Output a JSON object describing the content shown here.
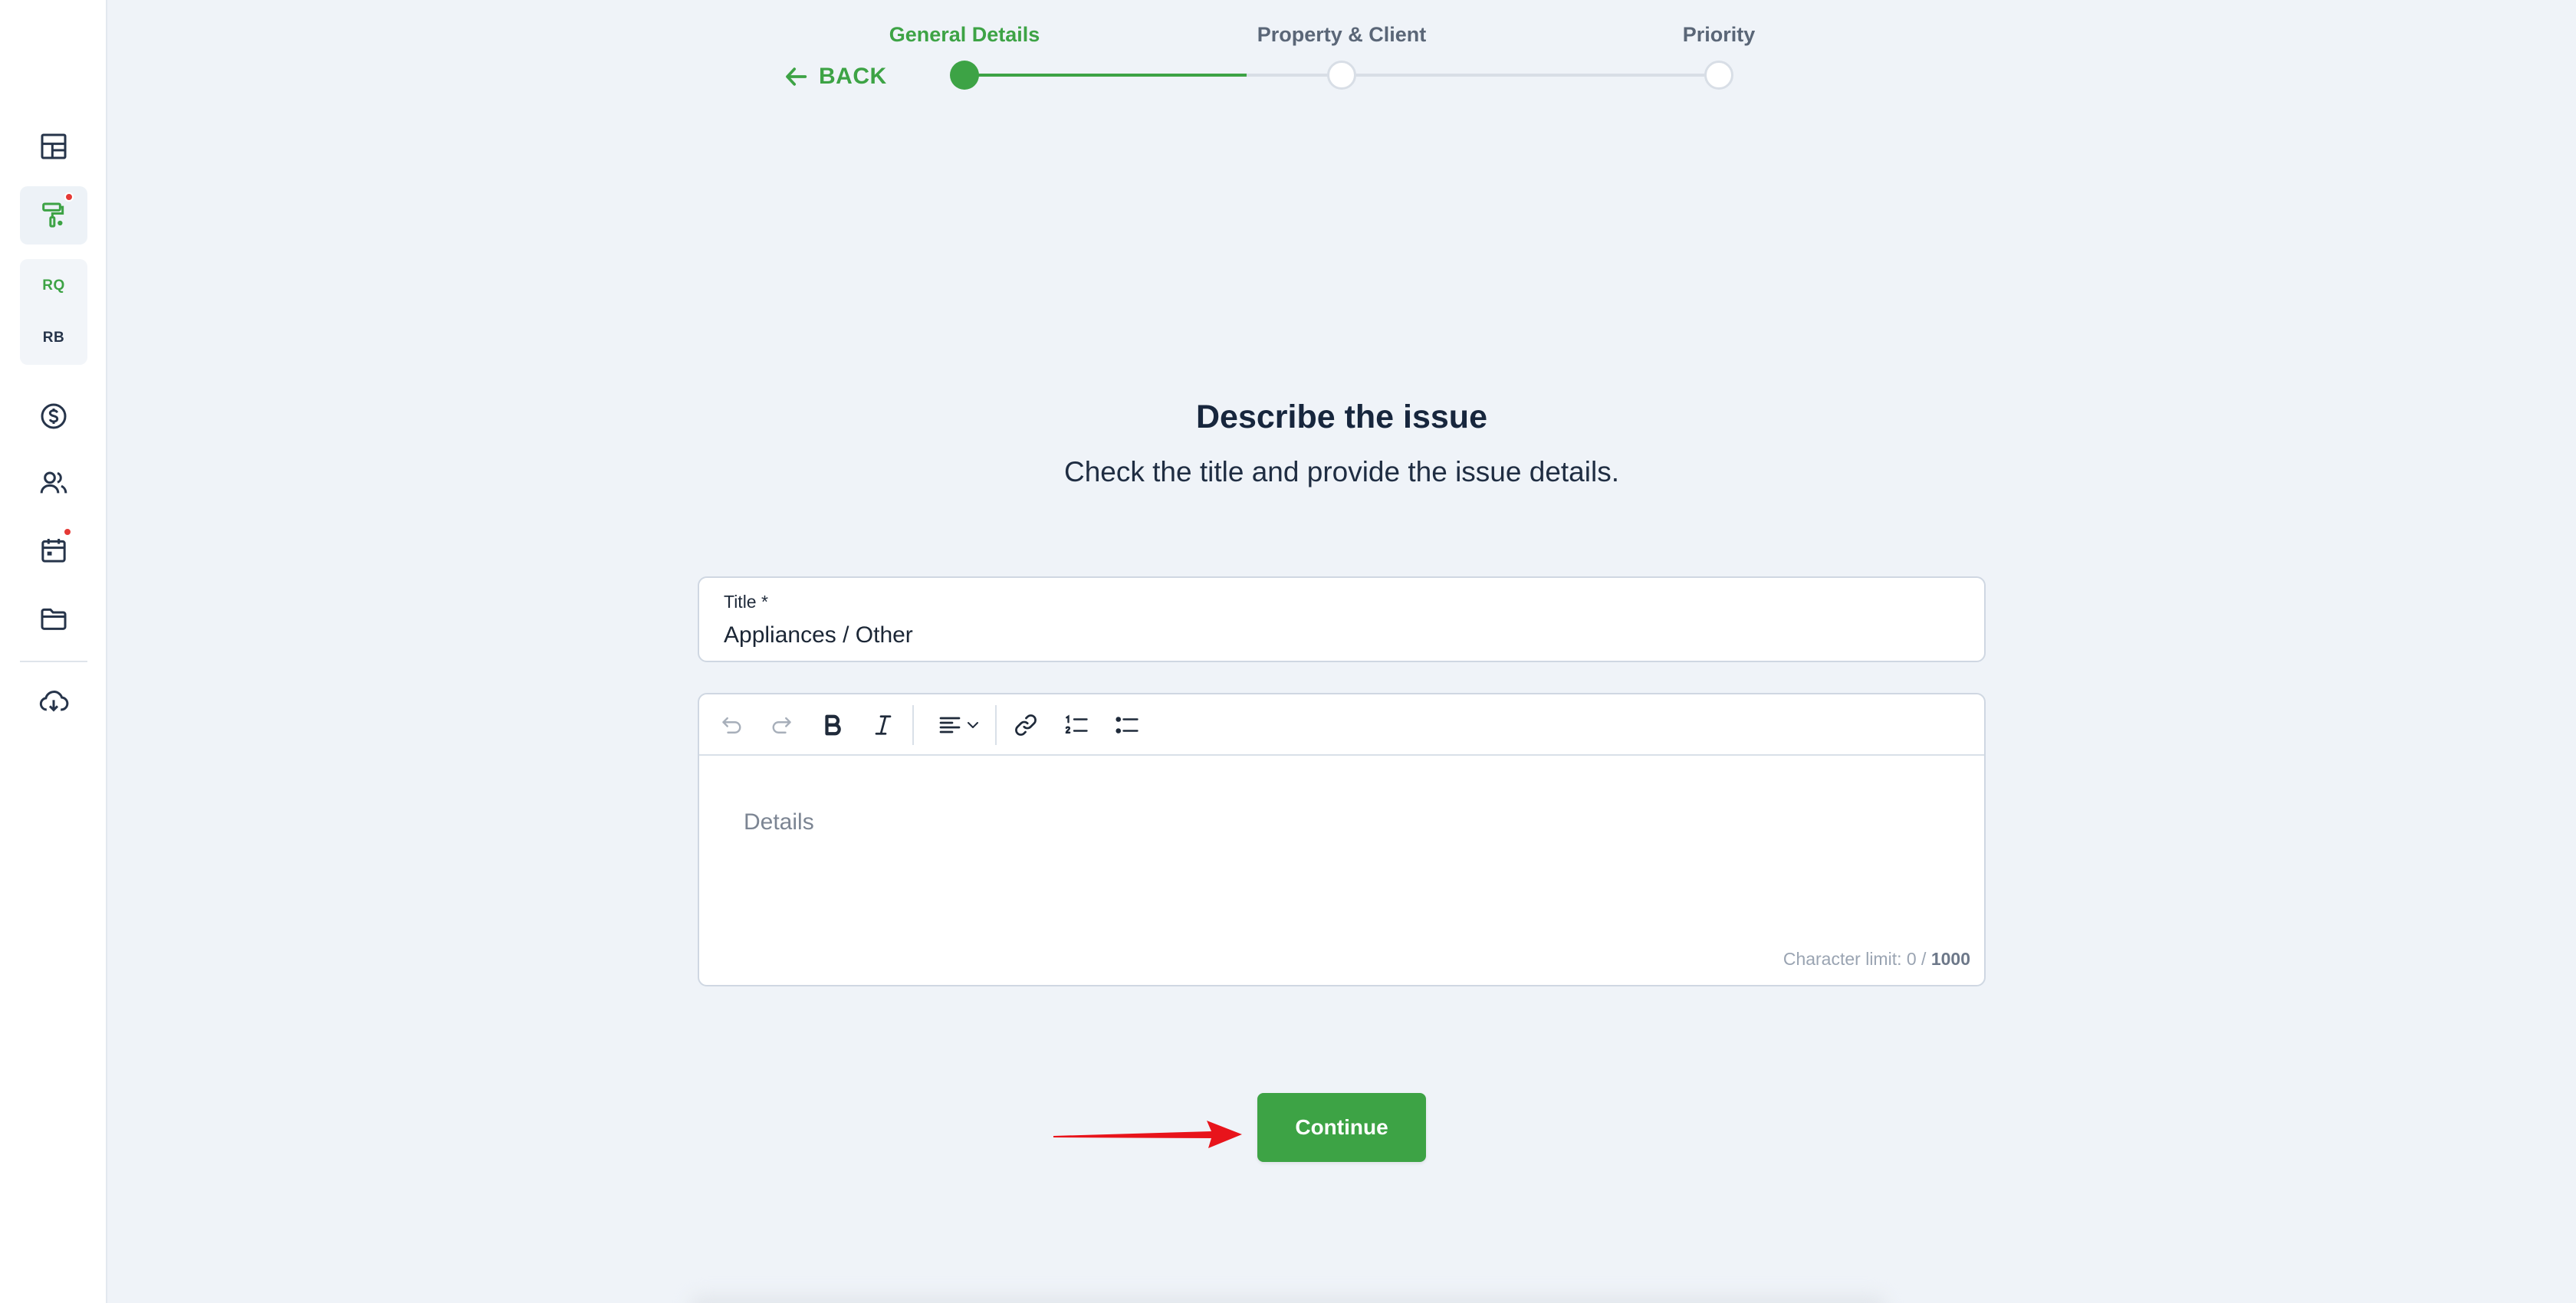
{
  "sidebar": {
    "items": [
      {
        "name": "dashboard",
        "icon": "dashboard-icon"
      },
      {
        "name": "maintenance",
        "icon": "paint-roller-icon",
        "active": true,
        "notification": true
      },
      {
        "name": "billing",
        "icon": "dollar-icon"
      },
      {
        "name": "contacts",
        "icon": "users-icon"
      },
      {
        "name": "calendar",
        "icon": "calendar-icon",
        "notification": true
      },
      {
        "name": "files",
        "icon": "folder-icon"
      },
      {
        "name": "download",
        "icon": "cloud-download-icon"
      }
    ],
    "tags": {
      "rq": "RQ",
      "rb": "RB"
    }
  },
  "stepper": {
    "back_label": "BACK",
    "steps": [
      {
        "label": "General Details",
        "status": "current"
      },
      {
        "label": "Property & Client",
        "status": "upcoming"
      },
      {
        "label": "Priority",
        "status": "upcoming"
      }
    ]
  },
  "main": {
    "title": "Describe the issue",
    "subtitle": "Check the title and provide the issue details.",
    "title_field": {
      "label": "Title *",
      "value": "Appliances / Other"
    },
    "details": {
      "placeholder": "Details",
      "char_limit_prefix": "Character limit: 0 / ",
      "char_limit_max": "1000"
    },
    "toolbar": [
      "undo-icon",
      "redo-icon",
      "bold-icon",
      "italic-icon",
      "align-left-icon",
      "chevron-down-icon",
      "link-icon",
      "numbered-list-icon",
      "bulleted-list-icon"
    ],
    "continue_label": "Continue"
  },
  "colors": {
    "accent": "#3da345",
    "background": "#eff3f8",
    "notification": "#e53935",
    "annotation_arrow": "#e8141b"
  }
}
